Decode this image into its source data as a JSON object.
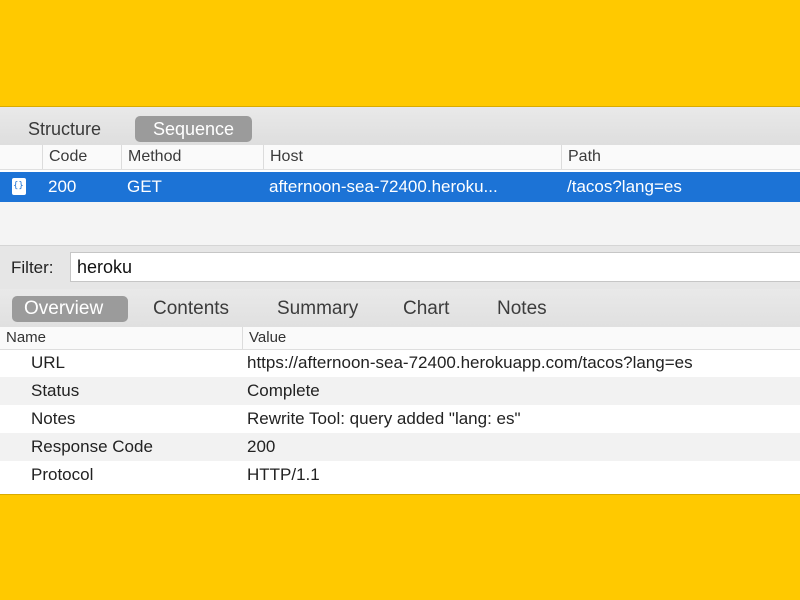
{
  "top_tabs": [
    "Structure",
    "Sequence"
  ],
  "request_table": {
    "columns": [
      "Code",
      "Method",
      "Host",
      "Path"
    ],
    "rows": [
      {
        "icon": "json-file-icon",
        "code": "200",
        "method": "GET",
        "host": "afternoon-sea-72400.heroku...",
        "path": "/tacos?lang=es"
      }
    ]
  },
  "filter": {
    "label": "Filter:",
    "value": "heroku"
  },
  "detail_tabs": [
    "Overview",
    "Contents",
    "Summary",
    "Chart",
    "Notes"
  ],
  "overview": {
    "columns": [
      "Name",
      "Value"
    ],
    "rows": [
      {
        "name": "URL",
        "value": "https://afternoon-sea-72400.herokuapp.com/tacos?lang=es"
      },
      {
        "name": "Status",
        "value": "Complete"
      },
      {
        "name": "Notes",
        "value": "Rewrite Tool: query added \"lang: es\""
      },
      {
        "name": "Response Code",
        "value": "200"
      },
      {
        "name": "Protocol",
        "value": "HTTP/1.1"
      }
    ]
  },
  "colors": {
    "background": "#FFC900",
    "selection": "#1C73D6",
    "active_tab": "#9B9B9B"
  }
}
